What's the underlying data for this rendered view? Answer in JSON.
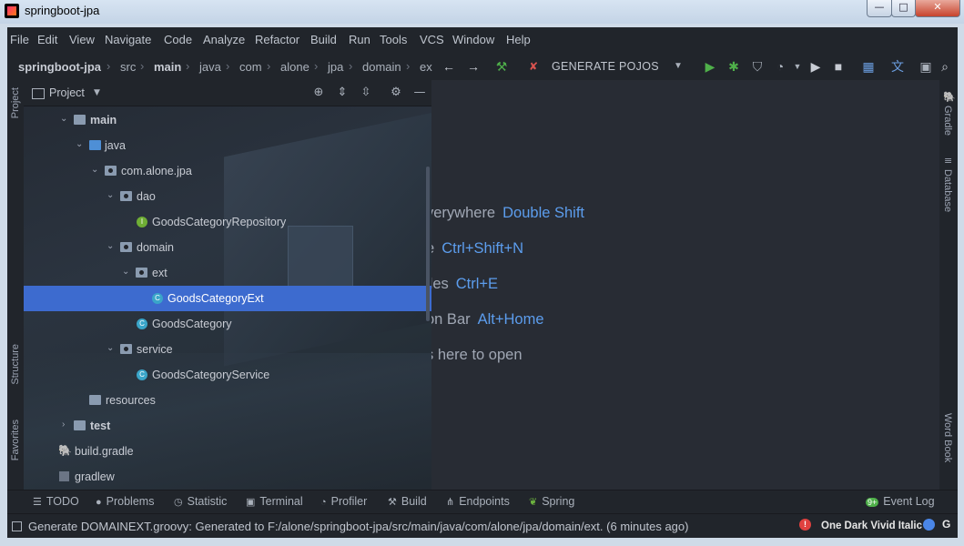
{
  "window": {
    "title": "springboot-jpa",
    "min": "—",
    "max": "□",
    "close": "✕"
  },
  "menu": [
    "File",
    "Edit",
    "View",
    "Navigate",
    "Code",
    "Analyze",
    "Refactor",
    "Build",
    "Run",
    "Tools",
    "VCS",
    "Window",
    "Help"
  ],
  "breadcrumb": [
    "springboot-jpa",
    "src",
    "main",
    "java",
    "com",
    "alone",
    "jpa",
    "domain",
    "ex"
  ],
  "toolbar": {
    "run_config": "GENERATE POJOS"
  },
  "project_panel": {
    "title": "Project",
    "tree": [
      {
        "label": "main",
        "type": "folder",
        "expanded": true
      },
      {
        "label": "java",
        "type": "source-folder",
        "expanded": true
      },
      {
        "label": "com.alone.jpa",
        "type": "package",
        "expanded": true
      },
      {
        "label": "dao",
        "type": "package",
        "expanded": true
      },
      {
        "label": "GoodsCategoryRepository",
        "type": "interface"
      },
      {
        "label": "domain",
        "type": "package",
        "expanded": true
      },
      {
        "label": "ext",
        "type": "package",
        "expanded": true
      },
      {
        "label": "GoodsCategoryExt",
        "type": "class",
        "selected": true
      },
      {
        "label": "GoodsCategory",
        "type": "class"
      },
      {
        "label": "service",
        "type": "package",
        "expanded": true
      },
      {
        "label": "GoodsCategoryService",
        "type": "class"
      },
      {
        "label": "resources",
        "type": "folder"
      },
      {
        "label": "test",
        "type": "folder",
        "expanded": false
      },
      {
        "label": "build.gradle",
        "type": "gradle-file"
      },
      {
        "label": "gradlew",
        "type": "file"
      }
    ]
  },
  "left_stripe": {
    "project": "Project",
    "structure": "Structure",
    "favorites": "Favorites"
  },
  "right_stripe": {
    "gradle": "Gradle",
    "database": "Database",
    "wordbook": "Word Book"
  },
  "editor_hints": [
    {
      "text": "verywhere",
      "key": "Double Shift"
    },
    {
      "text": "e",
      "key": "Ctrl+Shift+N"
    },
    {
      "text": "iles",
      "key": "Ctrl+E"
    },
    {
      "text": "on Bar",
      "key": "Alt+Home"
    },
    {
      "text": "s here to open",
      "key": ""
    }
  ],
  "bottom_tools": {
    "todo": "TODO",
    "problems": "Problems",
    "statistic": "Statistic",
    "terminal": "Terminal",
    "profiler": "Profiler",
    "build": "Build",
    "endpoints": "Endpoints",
    "spring": "Spring",
    "event_log": "Event Log",
    "event_badge": "9+"
  },
  "status": {
    "message": "Generate DOMAINEXT.groovy: Generated to F:/alone/springboot-jpa/src/main/java/com/alone/jpa/domain/ext. (6 minutes ago)",
    "theme": "One Dark Vivid Italic"
  },
  "colors": {
    "selection": "#3d6bcf",
    "shortcut": "#5c9ded",
    "run": "#4fb04a"
  }
}
